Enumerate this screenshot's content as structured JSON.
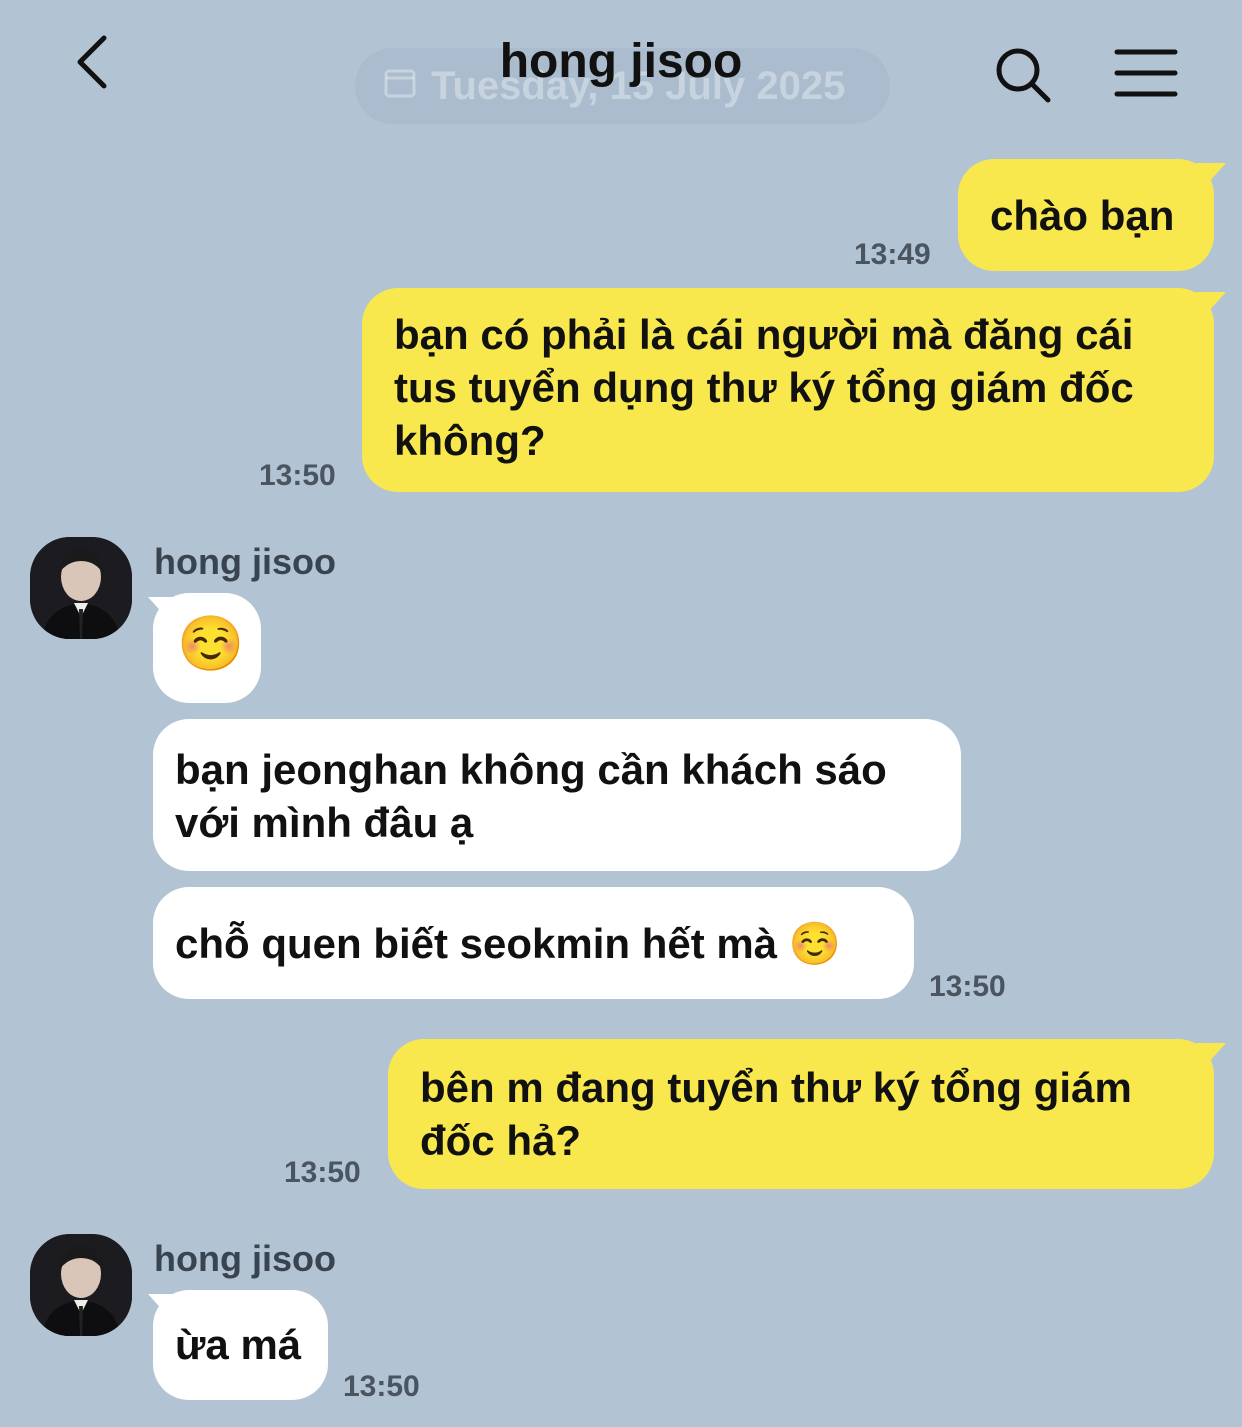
{
  "header": {
    "title": "hong jisoo",
    "date_pill": "Tuesday, 15 July 2025"
  },
  "contact": {
    "name": "hong jisoo"
  },
  "messages": [
    {
      "from": "me",
      "text": "chào bạn",
      "time": "13:49"
    },
    {
      "from": "me",
      "text": "bạn có phải là cái người mà đăng cái tus tuyển dụng thư ký tổng giám đốc không?",
      "time": "13:50"
    },
    {
      "from": "them",
      "text": "☺️"
    },
    {
      "from": "them",
      "text": "bạn jeonghan không cần khách sáo với mình đâu ạ"
    },
    {
      "from": "them",
      "text": "chỗ quen biết seokmin hết mà ☺️",
      "time": "13:50"
    },
    {
      "from": "me",
      "text": "bên m đang tuyển thư ký tổng giám đốc hả?",
      "time": "13:50"
    },
    {
      "from": "them",
      "text": "ừa má",
      "time": "13:50"
    }
  ],
  "colors": {
    "background": "#b2c4d3",
    "mine": "#f8e84d",
    "theirs": "#ffffff"
  },
  "icons": {
    "back": "chevron-left-icon",
    "search": "search-icon",
    "menu": "hamburger-menu-icon"
  }
}
